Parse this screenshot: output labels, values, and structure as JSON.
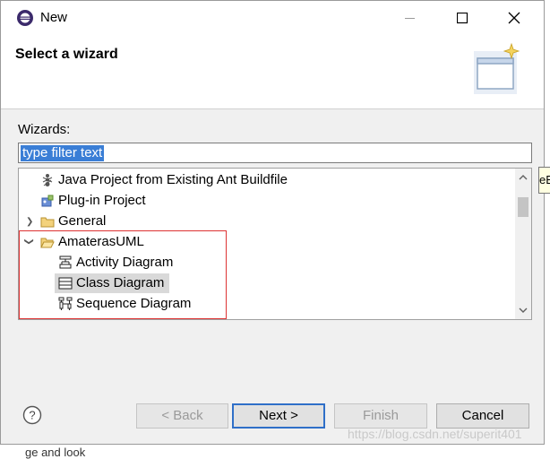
{
  "window": {
    "title": "New"
  },
  "banner": {
    "title": "Select a wizard"
  },
  "filter": {
    "label": "Wizards:",
    "value": "type filter text"
  },
  "tree": {
    "items": [
      {
        "label": "Java Project from Existing Ant Buildfile",
        "icon": "ant-icon"
      },
      {
        "label": "Plug-in Project",
        "icon": "plugin-icon"
      },
      {
        "label": "General",
        "icon": "folder-icon",
        "expanded": false
      },
      {
        "label": "AmaterasUML",
        "icon": "folder-open-icon",
        "expanded": true
      },
      {
        "label": "Activity Diagram",
        "icon": "activity-diagram-icon"
      },
      {
        "label": "Class Diagram",
        "icon": "class-diagram-icon",
        "selected": true
      },
      {
        "label": "Sequence Diagram",
        "icon": "sequence-diagram-icon"
      }
    ]
  },
  "tooltip_fragment": "eE",
  "buttons": {
    "back": "< Back",
    "next": "Next >",
    "finish": "Finish",
    "cancel": "Cancel"
  },
  "watermark": "https://blog.csdn.net/superit401",
  "bottom_text": "ge and look",
  "colors": {
    "selection": "#3a7ed6",
    "highlight_box": "#dd3333",
    "default_button_border": "#2f6fc8"
  }
}
